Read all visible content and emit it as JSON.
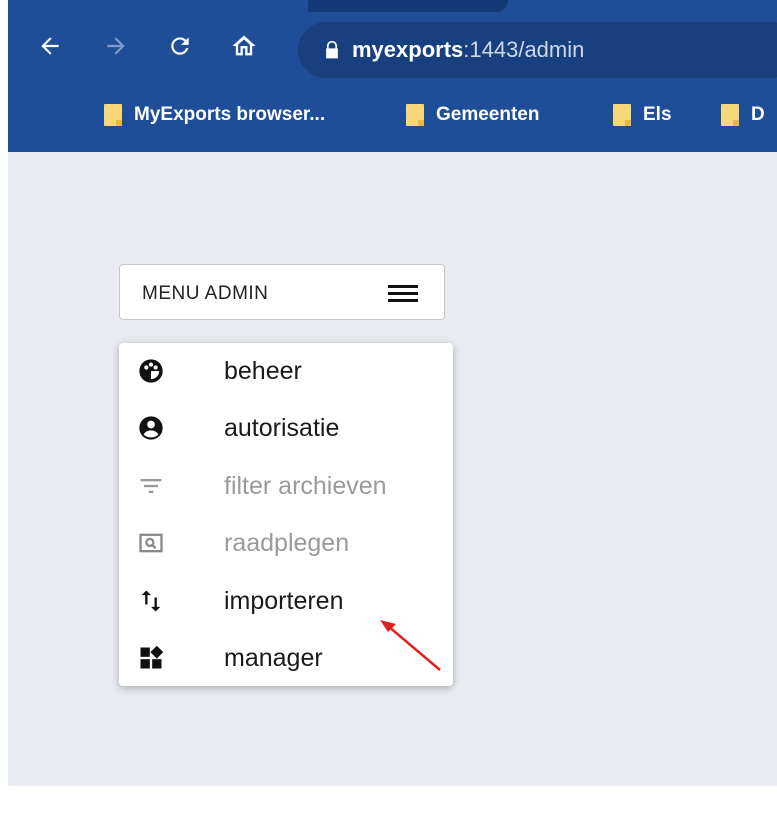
{
  "browser": {
    "url_host": "myexports",
    "url_rest": ":1443/admin",
    "bookmarks": [
      {
        "label": "MyExports browser..."
      },
      {
        "label": "Gemeenten"
      },
      {
        "label": "Els"
      },
      {
        "label": "D"
      }
    ],
    "colors": {
      "toolbar": "#1f4e98",
      "omnibox": "#183f7e"
    }
  },
  "menu": {
    "button_label": "MENU ADMIN",
    "items": [
      {
        "label": "beheer",
        "icon": "palette-icon",
        "disabled": false
      },
      {
        "label": "autorisatie",
        "icon": "account-circle-icon",
        "disabled": false
      },
      {
        "label": "filter archieven",
        "icon": "filter-icon",
        "disabled": true
      },
      {
        "label": "raadplegen",
        "icon": "search-box-icon",
        "disabled": true
      },
      {
        "label": "importeren",
        "icon": "swap-vert-icon",
        "disabled": false
      },
      {
        "label": "manager",
        "icon": "widgets-icon",
        "disabled": false
      }
    ]
  },
  "annotation": {
    "arrow_color": "#e02020"
  }
}
